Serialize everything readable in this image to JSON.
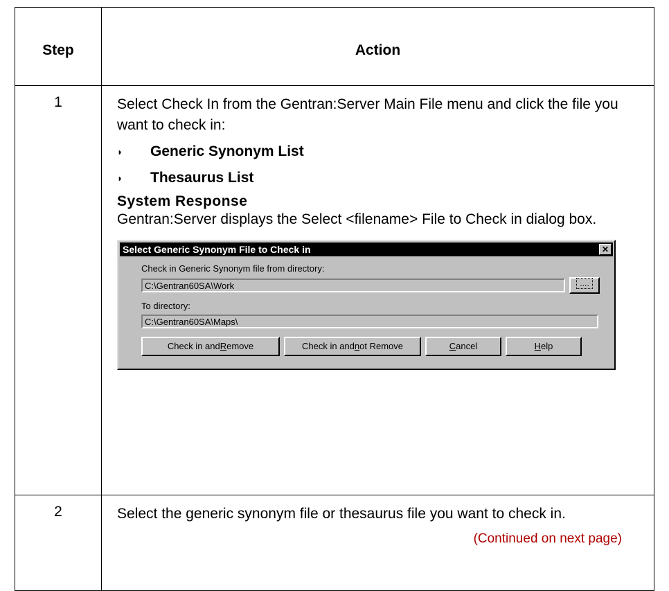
{
  "table": {
    "headers": [
      "Step",
      "Action"
    ],
    "rows": [
      {
        "step": "1",
        "intro": "Select Check In from the Gentran:Server Main File menu and click the file you want to check in:",
        "bullets": [
          "Generic Synonym List",
          "Thesaurus List"
        ],
        "system_response_heading": "System Response",
        "system_response_text": "Gentran:Server displays the Select <filename> File to Check in dialog box."
      },
      {
        "step": "2",
        "text": "Select the generic synonym file or thesaurus file you want to check in.",
        "continued": "(Continued on next page)"
      }
    ]
  },
  "bullet_icon": "right-half-circle-bullet",
  "dialog": {
    "title": "Select Generic Synonym File to Check in",
    "close_glyph": "✕",
    "from_label": "Check in Generic Synonym file from directory:",
    "from_value": "C:\\Gentran60SA\\Work",
    "browse_label": "....",
    "to_label": "To directory:",
    "to_value": "C:\\Gentran60SA\\Maps\\",
    "buttons": {
      "check_in_remove": {
        "pre": "Check in and ",
        "u": "R",
        "post": "emove"
      },
      "check_in_not_remove": {
        "pre": "Check in and ",
        "u": "n",
        "post": "ot Remove"
      },
      "cancel": {
        "pre": "",
        "u": "C",
        "post": "ancel"
      },
      "help": {
        "pre": "",
        "u": "H",
        "post": "elp"
      }
    }
  },
  "colors": {
    "continued": "#b00000",
    "dialog_bg": "#c0c0c0",
    "titlebar": "#000000"
  }
}
